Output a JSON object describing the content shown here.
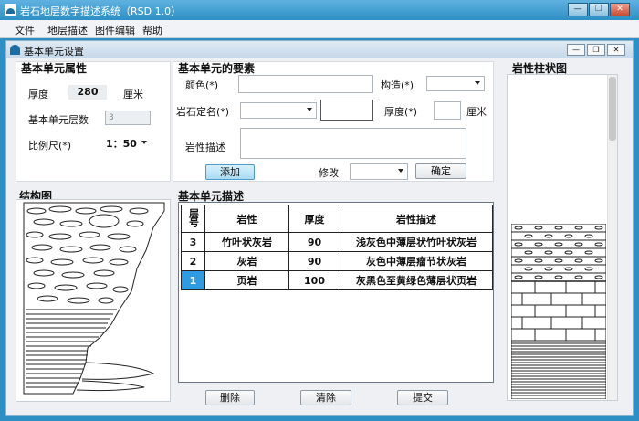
{
  "app": {
    "title": "岩石地层数字描述系统（RSD 1.0）"
  },
  "menu": [
    "文件",
    "地层描述",
    "图件编辑",
    "帮助"
  ],
  "window": {
    "title": "基本单元设置"
  },
  "props": {
    "header": "基本单元属性",
    "thickness_label": "厚度",
    "thickness_value": "280",
    "thickness_unit": "厘米",
    "layer_count_label": "基本单元层数",
    "layer_count_value": "3",
    "scale_label": "比例尺(*)",
    "scale_value": "1：50"
  },
  "elements": {
    "header": "基本单元的要素",
    "color_label": "颜色(*)",
    "structure_label": "构造(*)",
    "rock_name_label": "岩石定名(*)",
    "thickness_label": "厚度(*)",
    "thickness_unit": "厘米",
    "lithology_desc_label": "岩性描述",
    "add_button": "添加",
    "modify_label": "修改",
    "confirm_button": "确定"
  },
  "structure": {
    "header": "结构图"
  },
  "description": {
    "header": "基本单元描述",
    "columns": [
      "层号",
      "岩性",
      "厚度",
      "岩性描述"
    ],
    "rows": [
      {
        "id": "3",
        "lith": "竹叶状灰岩",
        "thick": "90",
        "desc": "浅灰色中薄层状竹叶状灰岩"
      },
      {
        "id": "2",
        "lith": "灰岩",
        "thick": "90",
        "desc": "灰色中薄层瘤节状灰岩"
      },
      {
        "id": "1",
        "lith": "页岩",
        "thick": "100",
        "desc": "灰黑色至黄绿色薄层状页岩"
      }
    ],
    "delete_button": "删除",
    "clear_button": "清除",
    "submit_button": "提交"
  },
  "column_chart": {
    "header": "岩性柱状图"
  }
}
